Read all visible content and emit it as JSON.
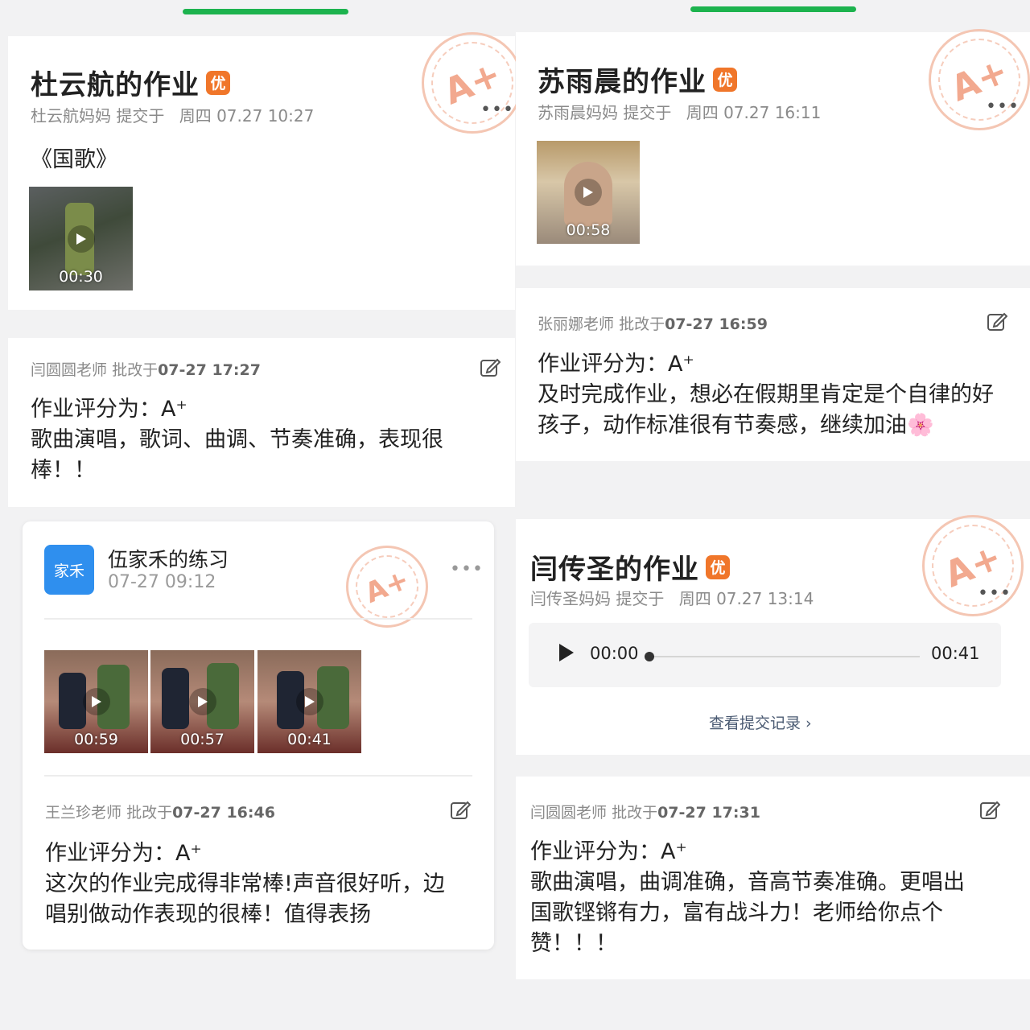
{
  "card1": {
    "title": "杜云航的作业",
    "badge": "优",
    "submitter": "杜云航妈妈",
    "submitted_label": "提交于",
    "submit_time": "周四 07.27 10:27",
    "song": "《国歌》",
    "video_duration": "00:30",
    "stamp_text": "A+",
    "teacher": "闫圆圆老师",
    "graded_label": "批改于",
    "graded_time": "07-27 17:27",
    "review_line1": "作业评分为：A⁺",
    "review_line2": "歌曲演唱，歌词、曲调、节奏准确，表现很",
    "review_line3": "棒！！"
  },
  "card2": {
    "title": "苏雨晨的作业",
    "badge": "优",
    "submitter": "苏雨晨妈妈",
    "submitted_label": "提交于",
    "submit_time": "周四 07.27 16:11",
    "video_duration": "00:58",
    "stamp_text": "A+",
    "teacher": "张丽娜老师",
    "graded_label": "批改于",
    "graded_time": "07-27 16:59",
    "review_line1": "作业评分为：A⁺",
    "review_line2": "及时完成作业，想必在假期里肯定是个自律的好",
    "review_line3": "孩子，动作标准很有节奏感，继续加油🌸"
  },
  "card3": {
    "avatar_text": "家禾",
    "title": "伍家禾的练习",
    "date": "07-27 09:12",
    "stamp_text": "A+",
    "videos": [
      "00:59",
      "00:57",
      "00:41"
    ],
    "teacher": "王兰珍老师",
    "graded_label": "批改于",
    "graded_time": "07-27 16:46",
    "review_line1": "作业评分为：A⁺",
    "review_line2": "这次的作业完成得非常棒!声音很好听，边",
    "review_line3": "唱别做动作表现的很棒！值得表扬"
  },
  "card4": {
    "title": "闫传圣的作业",
    "badge": "优",
    "submitter": "闫传圣妈妈",
    "submitted_label": "提交于",
    "submit_time": "周四 07.27 13:14",
    "stamp_text": "A+",
    "audio_current": "00:00",
    "audio_total": "00:41",
    "audio_progress": 0,
    "view_records": "查看提交记录 ›",
    "teacher": "闫圆圆老师",
    "graded_label": "批改于",
    "graded_time": "07-27 17:31",
    "review_line1": "作业评分为：A⁺",
    "review_line2": "歌曲演唱，曲调准确，音高节奏准确。更唱出",
    "review_line3": "国歌铿锵有力，富有战斗力！老师给你点个",
    "review_line4": "赞！！！"
  },
  "colors": {
    "green_accent": "#1db34e",
    "badge_orange": "#f0762a",
    "avatar_blue": "#2f8fee",
    "stamp_pink": "#f2a98f"
  }
}
